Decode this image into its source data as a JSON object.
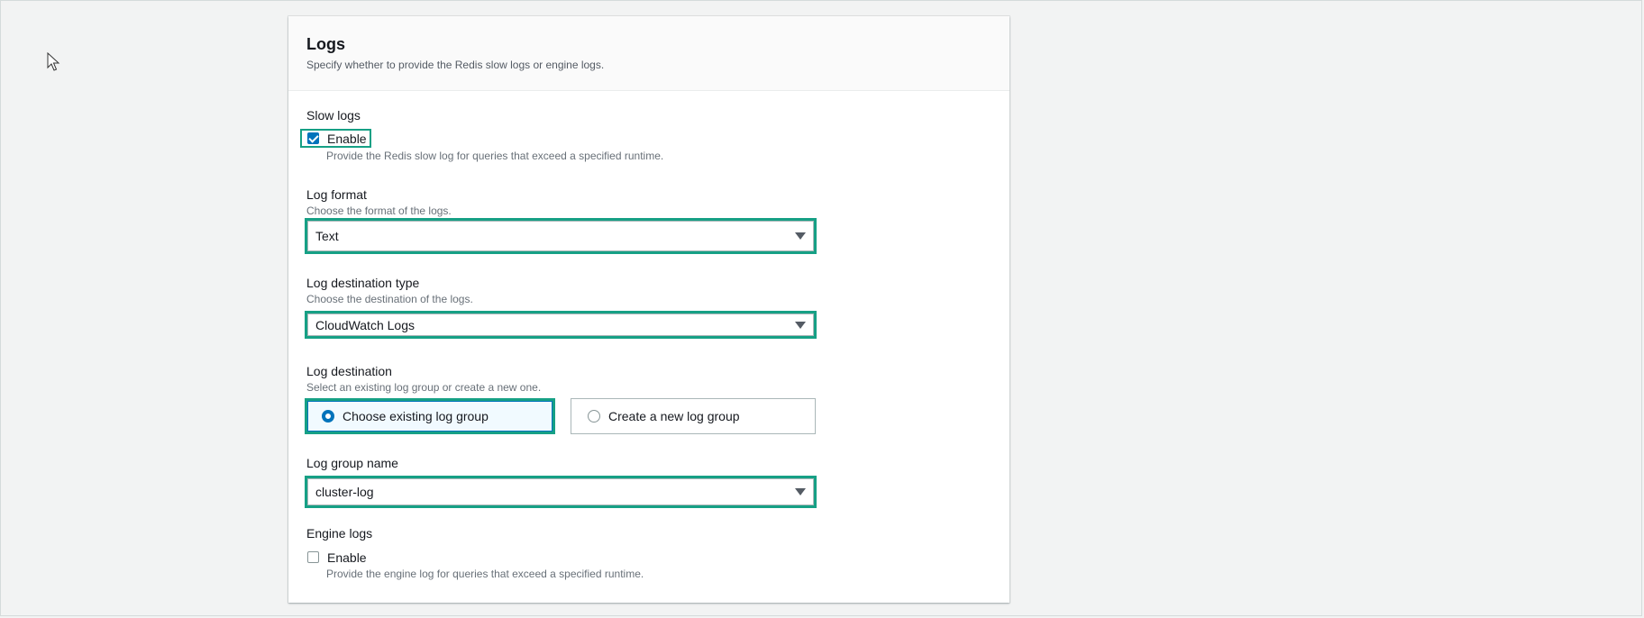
{
  "logs": {
    "title": "Logs",
    "description": "Specify whether to provide the Redis slow logs or engine logs."
  },
  "slow_logs": {
    "label": "Slow logs",
    "enable_label": "Enable",
    "enabled": true,
    "description": "Provide the Redis slow log for queries that exceed a specified runtime."
  },
  "log_format": {
    "label": "Log format",
    "description": "Choose the format of the logs.",
    "value": "Text"
  },
  "log_destination_type": {
    "label": "Log destination type",
    "description": "Choose the destination of the logs.",
    "value": "CloudWatch Logs"
  },
  "log_destination": {
    "label": "Log destination",
    "description": "Select an existing log group or create a new one.",
    "options": [
      {
        "label": "Choose existing log group",
        "selected": true
      },
      {
        "label": "Create a new log group",
        "selected": false
      }
    ]
  },
  "log_group_name": {
    "label": "Log group name",
    "value": "cluster-log"
  },
  "engine_logs": {
    "label": "Engine logs",
    "enable_label": "Enable",
    "enabled": false,
    "description": "Provide the engine log for queries that exceed a specified runtime."
  },
  "colors": {
    "highlight": "#16a085",
    "accent": "#0073bb",
    "page_bg": "#f2f3f3"
  },
  "icons": {
    "cursor": "mouse-pointer-icon",
    "dropdown": "caret-down-icon"
  }
}
